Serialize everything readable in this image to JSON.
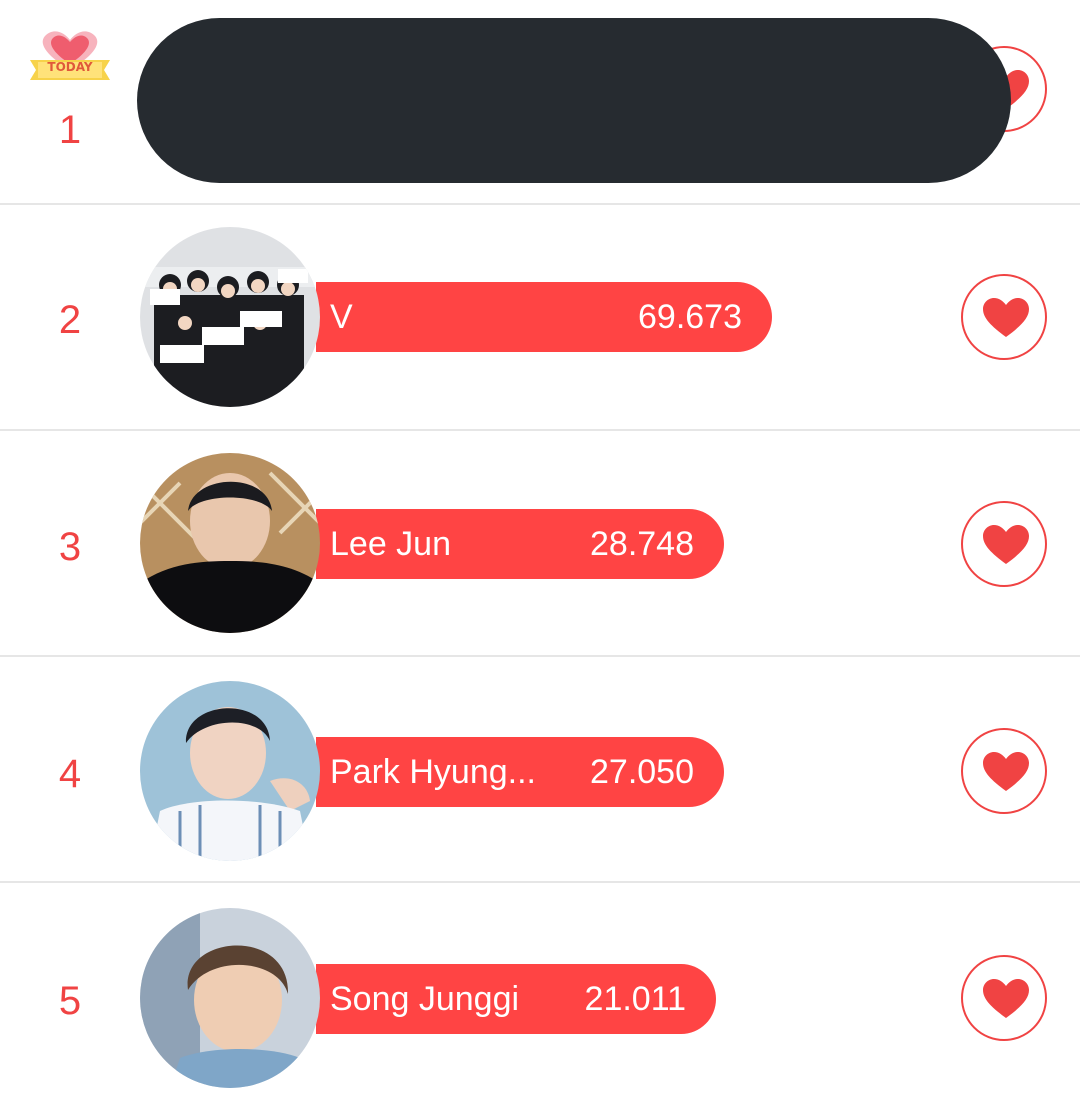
{
  "badge": {
    "today_label": "TODAY"
  },
  "colors": {
    "accent": "#f04343",
    "bar": "#ff4444",
    "redaction": "#262b30"
  },
  "ranking": [
    {
      "rank": "1",
      "name": "",
      "score": "",
      "redacted": true,
      "today": true
    },
    {
      "rank": "2",
      "name": "V",
      "score": "69.673"
    },
    {
      "rank": "3",
      "name": "Lee Jun",
      "score": "28.748"
    },
    {
      "rank": "4",
      "name": "Park Hyung...",
      "score": "27.050"
    },
    {
      "rank": "5",
      "name": "Song Junggi",
      "score": "21.011"
    }
  ],
  "icons": {
    "vote": "heart-icon",
    "today": "today-heart-badge-icon"
  }
}
